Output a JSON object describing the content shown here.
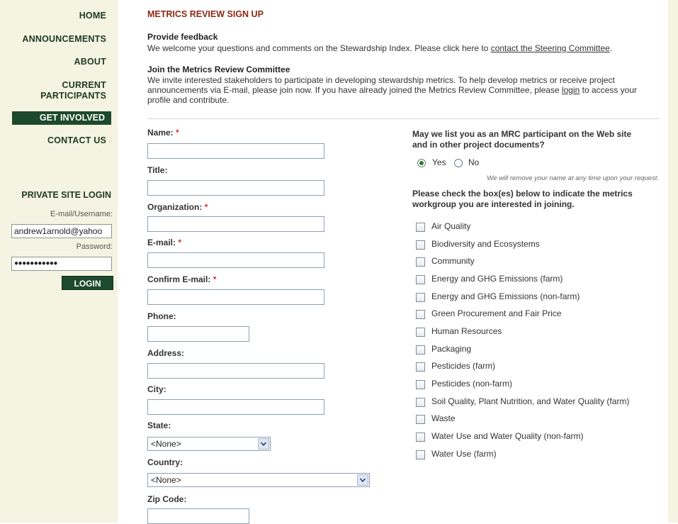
{
  "nav": {
    "home": "HOME",
    "announcements": "ANNOUNCEMENTS",
    "about": "ABOUT",
    "current_1": "CURRENT",
    "current_2": "PARTICIPANTS",
    "get_involved": "GET INVOLVED",
    "contact_us": "CONTACT US"
  },
  "login": {
    "title": "PRIVATE SITE LOGIN",
    "email_label": "E-mail/Username:",
    "email_value": "andrew1arnold@yahoo",
    "password_label": "Password:",
    "password_value": "●●●●●●●●●●●",
    "button": "LOGIN"
  },
  "page": {
    "title": "METRICS REVIEW SIGN UP",
    "feedback_head": "Provide feedback",
    "feedback_text": "We welcome your questions and comments on the Stewardship Index. Please click here to ",
    "feedback_link": "contact the Steering Committee",
    "feedback_end": ".",
    "join_head": "Join the Metrics Review Committee",
    "join_text": "We invite interested stakeholders to participate in developing stewardship metrics. To help develop metrics or receive project announcements via E-mail, please join now. If you have already joined the Metrics Review Committee, please ",
    "join_link": "login",
    "join_end": " to access your profile and contribute."
  },
  "form": {
    "name_label": "Name:",
    "title_label": "Title:",
    "org_label": "Organization:",
    "email_label": "E-mail:",
    "confirm_label": "Confirm E-mail:",
    "phone_label": "Phone:",
    "address_label": "Address:",
    "city_label": "City:",
    "state_label": "State:",
    "state_value": "<None>",
    "country_label": "Country:",
    "country_value": "<None>",
    "zip_label": "Zip Code:",
    "required_mark": "*"
  },
  "participation": {
    "question_1": "May we list you as an MRC participant on the Web site",
    "question_2": "and in other project documents?",
    "yes": "Yes",
    "no": "No",
    "selected": "Yes",
    "note": "We will remove your name at any time upon your request."
  },
  "workgroups": {
    "prompt_1": "Please check the box(es) below to indicate the metrics",
    "prompt_2": "workgroup you are interested in joining.",
    "items": [
      "Air Quality",
      "Biodiversity and Ecosystems",
      "Community",
      "Energy and GHG Emissions (farm)",
      "Energy and GHG Emissions (non-farm)",
      "Green Procurement and Fair Price",
      "Human Resources",
      "Packaging",
      "Pesticides (farm)",
      "Pesticides (non-farm)",
      "Soil Quality, Plant Nutrition, and Water Quality (farm)",
      "Waste",
      "Water Use and Water Quality (non-farm)",
      "Water Use (farm)"
    ]
  },
  "colors": {
    "nav_text": "#1d3a24",
    "nav_active_bg": "#1d4a2c",
    "title_color": "#8b2a12",
    "sidebar_bg": "#f5f3e2",
    "required": "#d03030"
  }
}
